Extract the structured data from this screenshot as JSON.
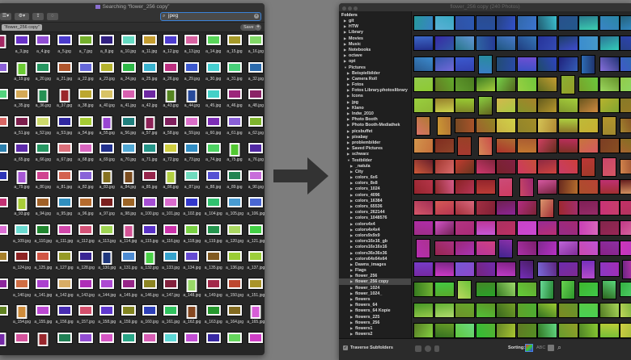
{
  "left_window": {
    "title": "Searching “flower_256 copy”",
    "search": {
      "value": "jpeg",
      "icon": "search-icon"
    },
    "scope_token": "“flower_256 copy”",
    "save_label": "Save",
    "add_label": "+",
    "rows": [
      [
        "a_3.jpg",
        "a_4.jpg",
        "a_5.jpg",
        "a_7.jpg",
        "a_8.jpg",
        "a_10.jpg",
        "a_11.jpg",
        "a_12.jpg",
        "a_13.jpg",
        "a_14.jpg",
        "a_15.jpg",
        "a_16.jpg"
      ],
      [
        "a_19.jpg",
        "a_20.jpg",
        "a_21.jpg",
        "a_22.jpg",
        "a_23.jpg",
        "a_24.jpg",
        "a_25.jpg",
        "a_26.jpg",
        "a_29.jpg",
        "a_30.jpg",
        "a_31.jpg",
        "a_32.jpg"
      ],
      [
        "a_35.jpg",
        "a_36.jpg",
        "a_37.jpg",
        "a_38.jpg",
        "a_40.jpg",
        "a_41.jpg",
        "a_42.jpg",
        "a_43.jpg",
        "a_44.jpg",
        "a_45.jpg",
        "a_46.jpg",
        "a_48.jpg"
      ],
      [
        "a_51.jpg",
        "a_52.jpg",
        "a_53.jpg",
        "a_54.jpg",
        "a_55.jpg",
        "a_56.jpg",
        "a_57.jpg",
        "a_58.jpg",
        "a_59.jpg",
        "a_60.jpg",
        "a_61.jpg",
        "a_62.jpg"
      ],
      [
        "a_65.jpg",
        "a_66.jpg",
        "a_67.jpg",
        "a_68.jpg",
        "a_69.jpg",
        "a_70.jpg",
        "a_71.jpg",
        "a_72.jpg",
        "a_73.jpg",
        "a_74.jpg",
        "a_75.jpg",
        "a_76.jpg"
      ],
      [
        "a_79.jpg",
        "a_80.jpg",
        "a_81.jpg",
        "a_82.jpg",
        "a_83.jpg",
        "a_84.jpg",
        "a_85.jpg",
        "a_86.jpg",
        "a_87.jpg",
        "a_88.jpg",
        "a_89.jpg",
        "a_90.jpg"
      ],
      [
        "a_93.jpg",
        "a_94.jpg",
        "a_95.jpg",
        "a_96.jpg",
        "a_97.jpg",
        "a_98.jpg",
        "a_100.jpg",
        "a_101.jpg",
        "a_102.jpg",
        "a_104.jpg",
        "a_105.jpg",
        "a_106.jpg"
      ],
      [
        "a_109.jpg",
        "a_110.jpg",
        "a_111.jpg",
        "a_112.jpg",
        "a_113.jpg",
        "a_114.jpg",
        "a_115.jpg",
        "a_116.jpg",
        "a_118.jpg",
        "a_119.jpg",
        "a_120.jpg",
        "a_121.jpg"
      ],
      [
        "a_124.jpg",
        "a_125.jpg",
        "a_127.jpg",
        "a_128.jpg",
        "a_130.jpg",
        "a_131.jpg",
        "a_132.jpg",
        "a_133.jpg",
        "a_134.jpg",
        "a_135.jpg",
        "a_136.jpg",
        "a_137.jpg"
      ],
      [
        "a_140.jpg",
        "a_141.jpg",
        "a_142.jpg",
        "a_143.jpg",
        "a_144.jpg",
        "a_145.jpg",
        "a_146.jpg",
        "a_147.jpg",
        "a_148.jpg",
        "a_149.jpg",
        "a_150.jpg",
        "a_151.jpg"
      ],
      [
        "a_154.jpg",
        "a_155.jpg",
        "a_156.jpg",
        "a_157.jpg",
        "a_158.jpg",
        "a_159.jpg",
        "a_160.jpg",
        "a_161.jpg",
        "a_162.jpg",
        "a_163.jpg",
        "a_164.jpg",
        "a_165.jpg"
      ],
      [
        "",
        "",
        "",
        "",
        "",
        "",
        "",
        "",
        "",
        "",
        "",
        ""
      ]
    ]
  },
  "right_window": {
    "title": "flower_256 copy (240 Photos)",
    "sidebar_header": "Folders",
    "folders": [
      {
        "name": "git",
        "level": 0
      },
      {
        "name": "HTW",
        "level": 0
      },
      {
        "name": "Library",
        "level": 0
      },
      {
        "name": "Movies",
        "level": 0
      },
      {
        "name": "Music",
        "level": 0
      },
      {
        "name": "Notebooks",
        "level": 0
      },
      {
        "name": "octave",
        "level": 0
      },
      {
        "name": "opt",
        "level": 0
      },
      {
        "name": "Pictures",
        "level": 0,
        "expanded": true
      },
      {
        "name": "Beispielbilder",
        "level": 1
      },
      {
        "name": "Camera Roll",
        "level": 1
      },
      {
        "name": "Fotos",
        "level": 1
      },
      {
        "name": "Fotos Library.photoslibrary",
        "level": 1
      },
      {
        "name": "Icons",
        "level": 1
      },
      {
        "name": "jpg",
        "level": 1
      },
      {
        "name": "Klano",
        "level": 1
      },
      {
        "name": "Indw_2010",
        "level": 1
      },
      {
        "name": "Photo Booth",
        "level": 1
      },
      {
        "name": "Photo Booth-Mediathek",
        "level": 1
      },
      {
        "name": "picsbuffet",
        "level": 1
      },
      {
        "name": "pixabay",
        "level": 1
      },
      {
        "name": "problembilder",
        "level": 1
      },
      {
        "name": "Saved Pictures",
        "level": 1
      },
      {
        "name": "schwarz",
        "level": 1
      },
      {
        "name": "Testbilder",
        "level": 1,
        "expanded": true
      },
      {
        "name": "_natula",
        "level": 2
      },
      {
        "name": "City",
        "level": 2
      },
      {
        "name": "colors_6x6",
        "level": 2
      },
      {
        "name": "colors_8x8",
        "level": 2
      },
      {
        "name": "colors_1024",
        "level": 2
      },
      {
        "name": "colors_4096",
        "level": 2
      },
      {
        "name": "colors_16384",
        "level": 2
      },
      {
        "name": "colors_65536",
        "level": 2
      },
      {
        "name": "colors_262144",
        "level": 2
      },
      {
        "name": "colors_1048576",
        "level": 2
      },
      {
        "name": "colors4x4",
        "level": 2
      },
      {
        "name": "colors4x4x4",
        "level": 2
      },
      {
        "name": "colors9x9x9",
        "level": 2
      },
      {
        "name": "colors16x16_gb",
        "level": 2
      },
      {
        "name": "colors16x16x16",
        "level": 2
      },
      {
        "name": "colors36x36x36",
        "level": 2
      },
      {
        "name": "colors64x64x64",
        "level": 2
      },
      {
        "name": "Dawns_images",
        "level": 2
      },
      {
        "name": "Flags",
        "level": 2
      },
      {
        "name": "flower_256",
        "level": 2
      },
      {
        "name": "flower_256 copy",
        "level": 2,
        "selected": true
      },
      {
        "name": "flower_1024",
        "level": 2
      },
      {
        "name": "flower_1024_",
        "level": 2
      },
      {
        "name": "flowers",
        "level": 2
      },
      {
        "name": "flowers_64",
        "level": 2
      },
      {
        "name": "flowers_64 Kopie",
        "level": 2
      },
      {
        "name": "flowers_225",
        "level": 2
      },
      {
        "name": "flowers_256",
        "level": 2
      },
      {
        "name": "flowers1",
        "level": 2
      },
      {
        "name": "flowers2",
        "level": 2
      }
    ],
    "traverse_label": "Traverse Subfolders",
    "traverse_checked": true,
    "sorting_label": "Sorting:",
    "sort_abc": "ABC",
    "accent": "#3b82d6"
  }
}
